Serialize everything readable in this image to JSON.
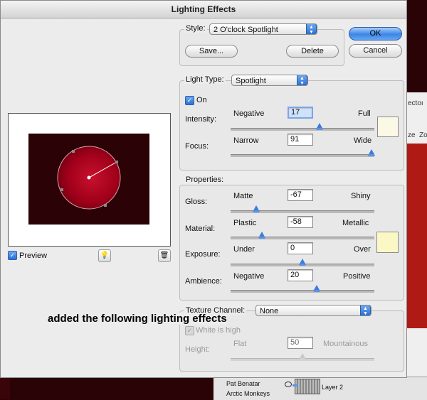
{
  "window": {
    "title": "Lighting Effects"
  },
  "style": {
    "label": "Style:",
    "value": "2 O'clock Spotlight",
    "save_label": "Save...",
    "delete_label": "Delete"
  },
  "buttons": {
    "ok": "OK",
    "cancel": "Cancel"
  },
  "light_type": {
    "label": "Light Type:",
    "value": "Spotlight",
    "on_label": "On",
    "on_checked": true,
    "intensity": {
      "label": "Intensity:",
      "min": "Negative",
      "max": "Full",
      "value": "17",
      "fraction": 0.62
    },
    "focus": {
      "label": "Focus:",
      "min": "Narrow",
      "max": "Wide",
      "value": "91",
      "fraction": 0.98
    },
    "swatch_color": "#fbf8e6"
  },
  "properties": {
    "label": "Properties:",
    "gloss": {
      "label": "Gloss:",
      "min": "Matte",
      "max": "Shiny",
      "value": "-67",
      "fraction": 0.18
    },
    "material": {
      "label": "Material:",
      "min": "Plastic",
      "max": "Metallic",
      "value": "-58",
      "fraction": 0.22
    },
    "exposure": {
      "label": "Exposure:",
      "min": "Under",
      "max": "Over",
      "value": "0",
      "fraction": 0.5
    },
    "ambience": {
      "label": "Ambience:",
      "min": "Negative",
      "max": "Positive",
      "value": "20",
      "fraction": 0.6
    },
    "swatch_color": "#fbf8c6"
  },
  "texture": {
    "label": "Texture Channel:",
    "value": "None",
    "white_is_high_label": "White is high",
    "height": {
      "label": "Height:",
      "min": "Flat",
      "max": "Mountainous",
      "value": "50",
      "fraction": 0.5
    }
  },
  "preview": {
    "label": "Preview",
    "checked": true
  },
  "caption": "added the following lighting effects",
  "background": {
    "tab_text": "ectoı",
    "tab_sub": "ze",
    "tab_sub2": "Zo",
    "layers": [
      "Pat Benatar",
      "Arctic Monkeys"
    ],
    "layer_name": "Layer 2"
  },
  "colors": {
    "accent": "#3d7bd8",
    "spot": "#b0001c"
  }
}
